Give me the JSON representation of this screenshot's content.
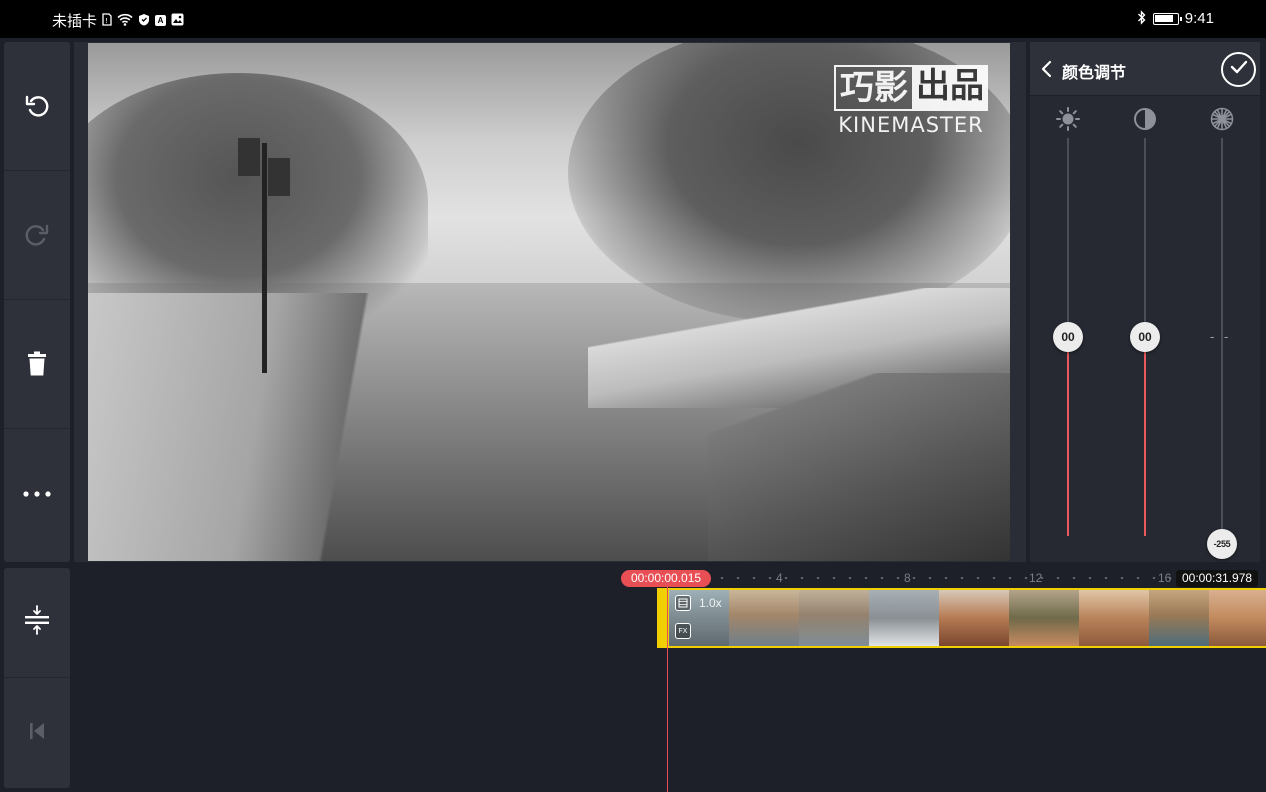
{
  "status_bar": {
    "sim_status": "未插卡",
    "icons": [
      "sim-icon",
      "wifi-icon",
      "shield-icon",
      "a-icon",
      "image-icon"
    ],
    "bluetooth_icon": "bluetooth-icon",
    "battery_level": 0.85,
    "time": "9:41"
  },
  "left_toolbar": {
    "buttons": [
      "undo-icon",
      "redo-icon",
      "delete-icon",
      "more-icon"
    ],
    "redo_enabled": false
  },
  "preview": {
    "watermark_left": "巧影",
    "watermark_right": "出品",
    "watermark_brand": "KINEMASTER"
  },
  "color_panel": {
    "title": "颜色调节",
    "back_icon": "chevron-left-icon",
    "confirm_icon": "check-icon",
    "sliders": [
      {
        "name": "brightness",
        "icon": "brightness-icon",
        "value": "00",
        "level": 0.5
      },
      {
        "name": "contrast",
        "icon": "contrast-icon",
        "value": "00",
        "level": 0.5
      },
      {
        "name": "saturation",
        "icon": "saturation-icon",
        "value": "- -",
        "min_label": "-255",
        "level": 0.0
      }
    ],
    "accent_color": "#e8585c"
  },
  "timeline": {
    "current_time": "00:00:00.015",
    "total_time": "00:00:31.978",
    "ruler_marks": [
      "4",
      "8",
      "12",
      "16"
    ],
    "clip_speed": "1.0x",
    "clip_border_color": "#f0d000",
    "playhead_color": "#e84f54"
  },
  "left_toolbar_2": {
    "buttons": [
      "split-icon",
      "skip-to-start-icon"
    ]
  }
}
